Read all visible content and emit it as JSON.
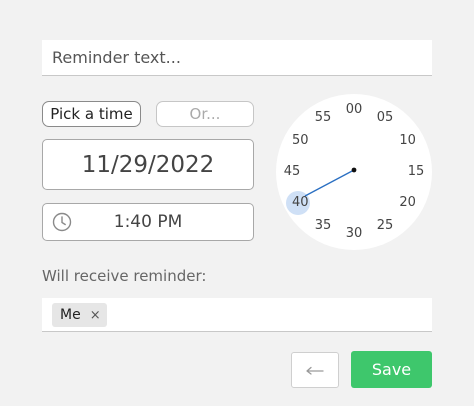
{
  "reminder": {
    "placeholder": "Reminder text..."
  },
  "time_mode": {
    "pick_label": "Pick a time",
    "or_label": "Or..."
  },
  "date": {
    "value": "11/29/2022"
  },
  "time": {
    "value": "1:40 PM",
    "icon": "clock-icon"
  },
  "clock": {
    "numbers": [
      "00",
      "05",
      "10",
      "15",
      "20",
      "25",
      "30",
      "35",
      "40",
      "45",
      "50",
      "55"
    ],
    "selected": "40",
    "accent": "#2a6fc2",
    "highlight": "#cfe0f6"
  },
  "recipients": {
    "label": "Will receive reminder:",
    "chips": [
      {
        "name": "Me",
        "remove": "×"
      }
    ]
  },
  "actions": {
    "back_icon": "return-arrow-icon",
    "save_label": "Save",
    "save_color": "#3ec76c"
  }
}
